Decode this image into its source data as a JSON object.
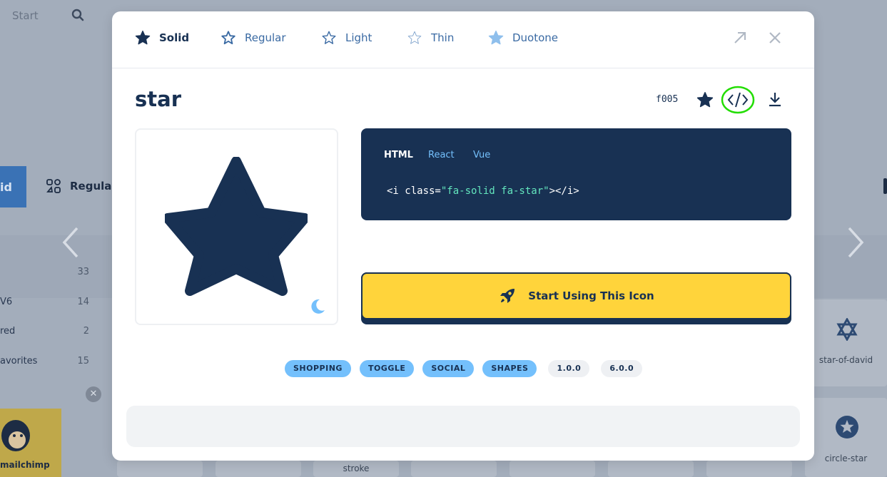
{
  "background": {
    "nav_start": "Start",
    "active_tab_label": "id",
    "regular_tab_label": "Regular",
    "categories": [
      {
        "label": "",
        "count": "33"
      },
      {
        "label": "V6",
        "count": "14"
      },
      {
        "label": "red",
        "count": "2"
      },
      {
        "label": "avorites",
        "count": "15"
      }
    ],
    "grid_labels": {
      "star_of_david": "star-of-david",
      "circle_star": "circle-star",
      "stroke": "stroke"
    },
    "mailchimp_label": "mailchimp"
  },
  "modal": {
    "style_tabs": [
      {
        "label": "Solid",
        "active": true
      },
      {
        "label": "Regular",
        "active": false
      },
      {
        "label": "Light",
        "active": false
      },
      {
        "label": "Thin",
        "active": false
      },
      {
        "label": "Duotone",
        "active": false
      }
    ],
    "icon_name": "star",
    "unicode": "f005",
    "code_tabs": [
      "HTML",
      "React",
      "Vue"
    ],
    "code": {
      "open": "<i class=",
      "attr": "\"fa-solid fa-star\"",
      "close": "></i>"
    },
    "cta_label": "Start Using This Icon",
    "tags": [
      {
        "label": "SHOPPING",
        "kind": "category"
      },
      {
        "label": "TOGGLE",
        "kind": "category"
      },
      {
        "label": "SOCIAL",
        "kind": "category"
      },
      {
        "label": "SHAPES",
        "kind": "category"
      },
      {
        "label": "1.0.0",
        "kind": "version"
      },
      {
        "label": "6.0.0",
        "kind": "version"
      }
    ]
  },
  "colors": {
    "navy": "#183153",
    "accent_blue": "#74c0fc",
    "yellow": "#ffd43b",
    "code_green": "#63e6be",
    "highlight_green": "#22dd00"
  },
  "icons": [
    "search-icon",
    "star-icon",
    "code-icon",
    "download-icon",
    "expand-icon",
    "close-icon",
    "moon-icon",
    "rocket-icon",
    "chevron-left-icon",
    "chevron-right-icon",
    "star-of-david-icon",
    "circle-star-icon"
  ]
}
